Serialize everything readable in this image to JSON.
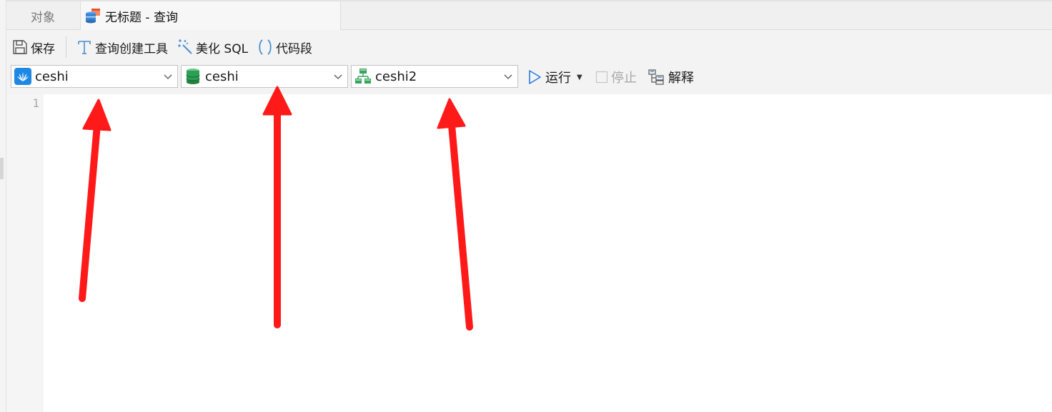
{
  "tabs": {
    "objects_label": "对象",
    "query_label": "无标题 - 查询"
  },
  "toolbar": {
    "save_label": "保存",
    "query_builder_label": "查询创建工具",
    "beautify_label": "美化 SQL",
    "snippet_label": "代码段"
  },
  "selectors": {
    "connection": "ceshi",
    "database": "ceshi",
    "schema": "ceshi2"
  },
  "actions": {
    "run_label": "运行",
    "stop_label": "停止",
    "explain_label": "解释"
  },
  "editor": {
    "line_numbers": [
      "1"
    ]
  },
  "annotations": {
    "arrow_color": "#ff1a1a",
    "arrow_count": 3
  },
  "colors": {
    "accent": "#2a7bd8",
    "connection_icon": "#1e88e5",
    "database_icon": "#2e9e54",
    "schema_icon": "#3aa35f"
  },
  "icons": [
    "query-tab-icon",
    "save-icon",
    "query-builder-icon",
    "magic-wand-icon",
    "snippet-icon",
    "huawei-connection-icon",
    "database-icon",
    "schema-icon",
    "chevron-down-icon",
    "play-icon",
    "stop-checkbox-icon",
    "explain-icon"
  ]
}
